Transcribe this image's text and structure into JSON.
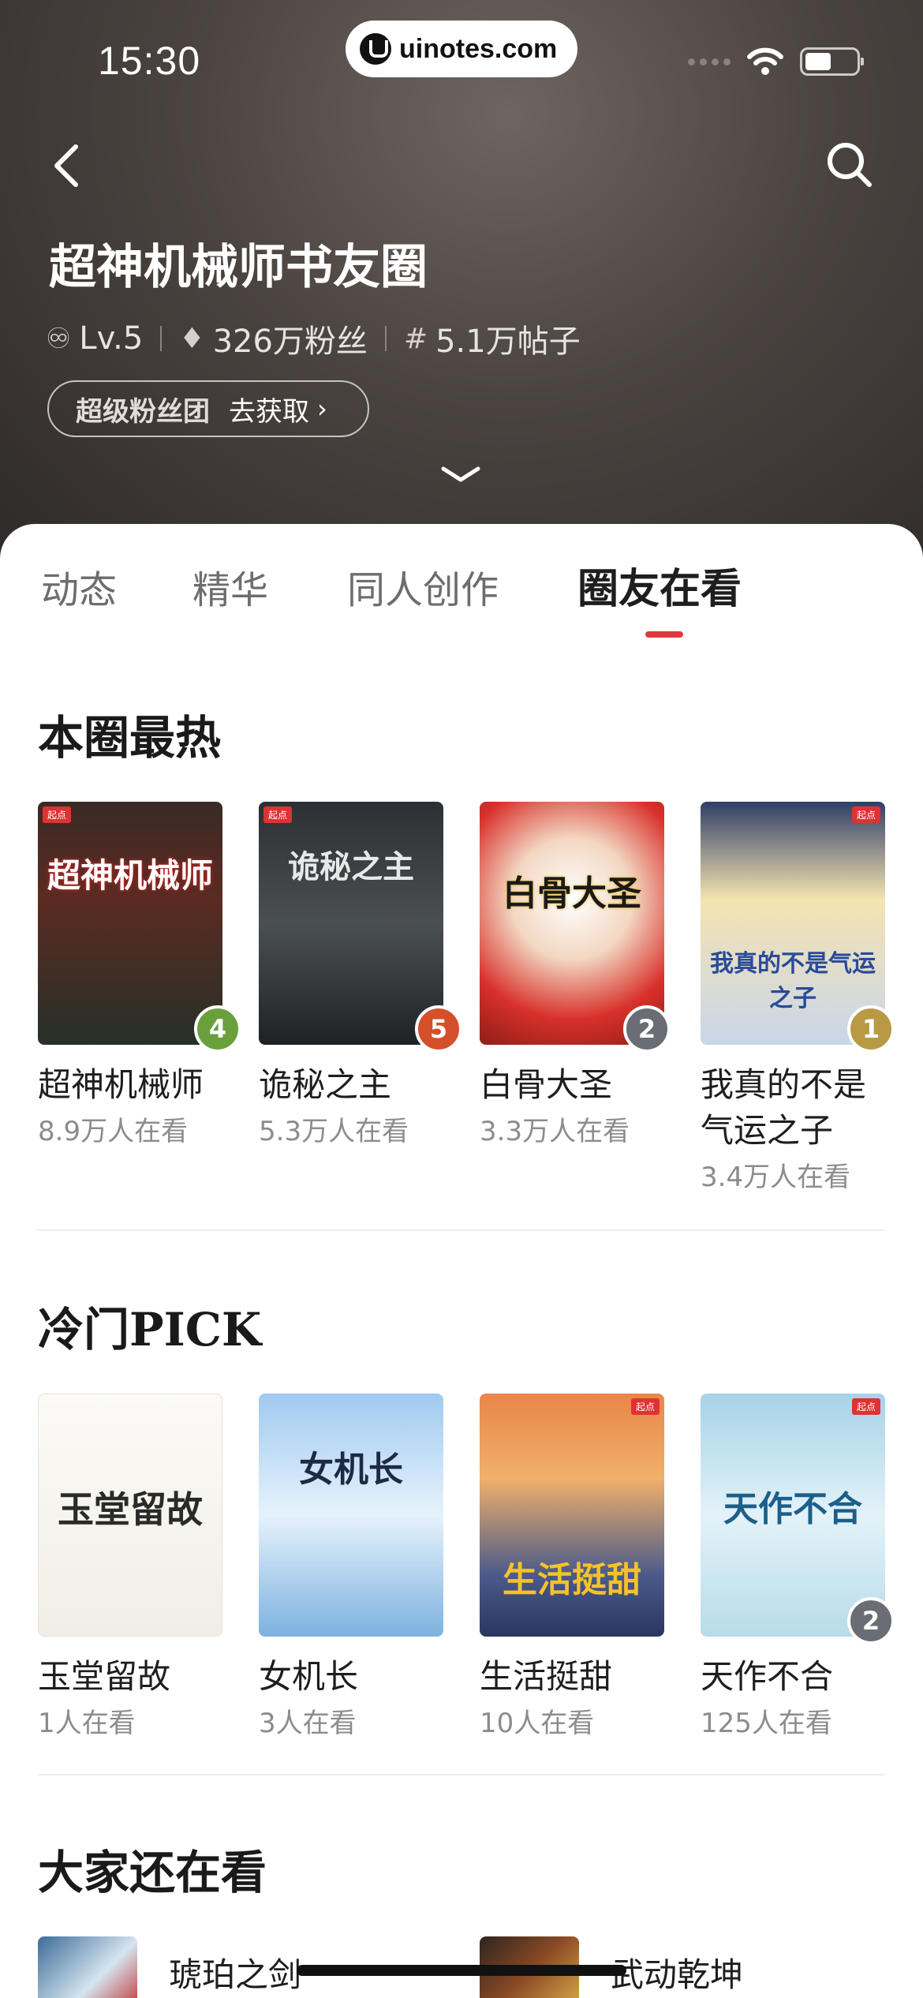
{
  "status": {
    "time": "15:30",
    "url": "uinotes.com"
  },
  "header": {
    "title": "超神机械师书友圈",
    "level": "Lv.5",
    "fans": "326万粉丝",
    "posts": "5.1万帖子",
    "fan_group_label": "超级粉丝团",
    "fan_group_action": "去获取"
  },
  "tabs": [
    {
      "label": "动态"
    },
    {
      "label": "精华"
    },
    {
      "label": "同人创作"
    },
    {
      "label": "圈友在看"
    }
  ],
  "hot": {
    "title": "本圈最热",
    "books": [
      {
        "name": "超神机械师",
        "count": "8.9万人在看",
        "rank": "4",
        "cover_text": "超神机械师"
      },
      {
        "name": "诡秘之主",
        "count": "5.3万人在看",
        "rank": "5",
        "cover_text": "诡秘之主"
      },
      {
        "name": "白骨大圣",
        "count": "3.3万人在看",
        "rank": "2",
        "cover_text": "白骨大圣"
      },
      {
        "name_line1": "我真的不是",
        "name_line2": "气运之子",
        "count": "3.4万人在看",
        "rank": "1",
        "cover_text": "我真的不是气运之子"
      }
    ]
  },
  "cold": {
    "title": "冷门PICK",
    "books": [
      {
        "name": "玉堂留故",
        "count": "1人在看",
        "cover_text": "玉堂留故"
      },
      {
        "name": "女机长",
        "count": "3人在看",
        "cover_text": "女机长"
      },
      {
        "name": "生活挺甜",
        "count": "10人在看",
        "cover_text": "生活挺甜"
      },
      {
        "name": "天作不合",
        "count": "125人在看",
        "rank": "2",
        "cover_text": "天作不合"
      }
    ]
  },
  "also": {
    "title": "大家还在看",
    "items": [
      {
        "name": "琥珀之剑"
      },
      {
        "name": "武动乾坤"
      }
    ]
  },
  "colors": {
    "accent": "#e0383e",
    "gold": "#c7a33a",
    "silver": "#8c8f94"
  }
}
